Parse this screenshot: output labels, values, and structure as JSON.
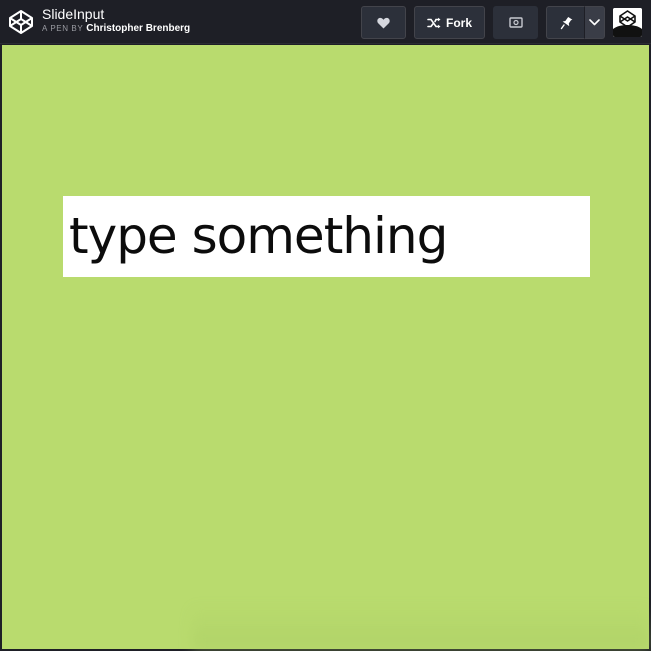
{
  "header": {
    "pen_title": "SlideInput",
    "byline_prefix": "A PEN BY",
    "author": "Christopher Brenberg",
    "fork_label": "Fork"
  },
  "icons": {
    "logo": "codepen-logo-icon",
    "heart": "heart-icon",
    "fork": "fork-icon",
    "view": "view-change-icon",
    "pin": "pin-icon",
    "menu": "chevron-down-icon",
    "avatar": "codepen-avatar-icon"
  },
  "preview": {
    "input_value": "type something",
    "background_color": "#b9db6e"
  },
  "colors": {
    "topbar_bg": "#1e1f26",
    "button_bg": "#2c303a",
    "input_bg": "#ffffff",
    "text": "#0c0c0c"
  }
}
